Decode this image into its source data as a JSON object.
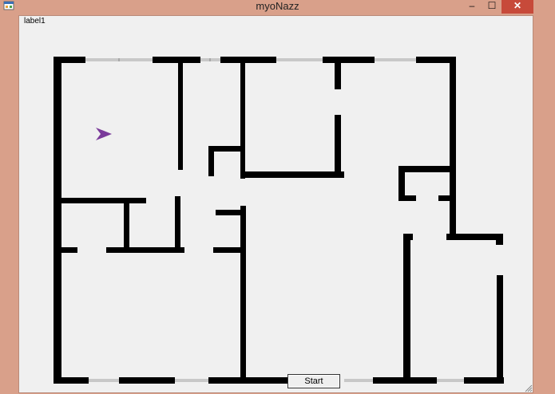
{
  "window": {
    "title": "myoNazz",
    "controls": {
      "minimize": "–",
      "maximize": "☐",
      "close": "✕"
    }
  },
  "form": {
    "label1": "label1",
    "start_button": "Start"
  },
  "icons": {
    "app": "app-icon",
    "cursor": "purple-arrow-cursor",
    "resize": "resize-grip-icon"
  },
  "colors": {
    "titlebar": "#d9a08a",
    "client_bg": "#f0f0f0",
    "wall": "#000000",
    "cursor": "#7a3a9a",
    "close_button": "#c74a3a"
  }
}
